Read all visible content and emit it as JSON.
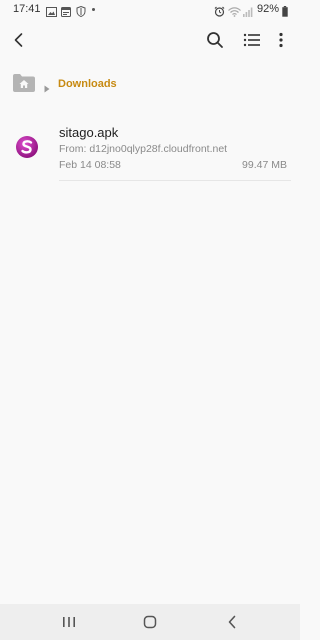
{
  "status_bar": {
    "time": "17:41",
    "battery": "92%",
    "icons": [
      "gallery-icon",
      "calendar-icon",
      "shield-icon",
      "alarm-icon",
      "wifi-icon",
      "signal-icon",
      "battery-icon"
    ]
  },
  "toolbar": {
    "icons": [
      "back-arrow-icon",
      "search-icon",
      "list-view-icon",
      "more-options-icon"
    ]
  },
  "breadcrumb": {
    "home_icon": "home-folder-icon",
    "current": "Downloads"
  },
  "files": [
    {
      "name": "sitago.apk",
      "source": "From: d12jno0qlyp28f.cloudfront.net",
      "date": "Feb 14 08:58",
      "size": "99.47 MB",
      "icon": "app-icon"
    }
  ],
  "nav_bar": {
    "icons": [
      "recents-icon",
      "home-icon",
      "back-icon"
    ]
  },
  "colors": {
    "background": "#f9f9f9",
    "breadcrumb_accent": "#c78a12",
    "nav_bar": "#eeeeee",
    "app_icon": "#b0179a"
  }
}
